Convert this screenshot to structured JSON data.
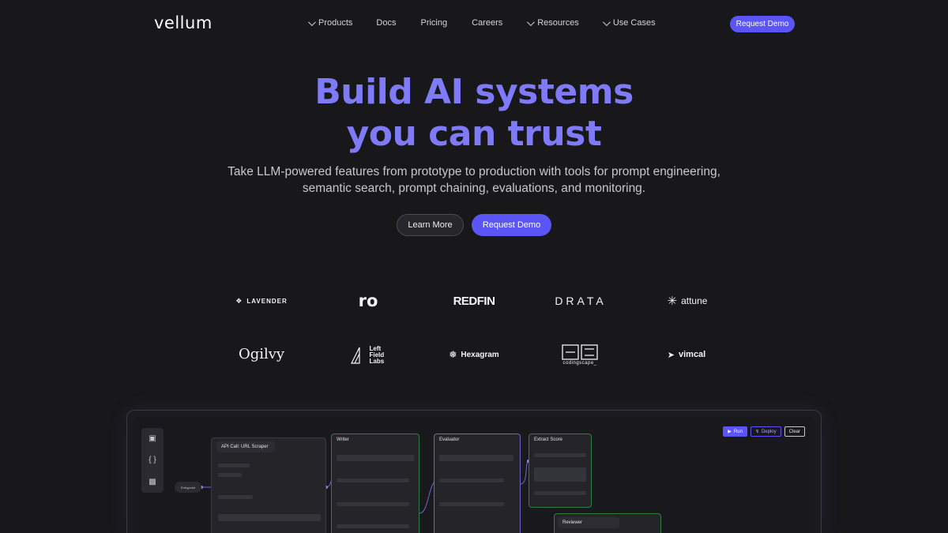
{
  "brand": {
    "name": "vellum"
  },
  "nav": {
    "items": [
      {
        "label": "Products",
        "dropdown": true
      },
      {
        "label": "Docs",
        "dropdown": false
      },
      {
        "label": "Pricing",
        "dropdown": false
      },
      {
        "label": "Careers",
        "dropdown": false
      },
      {
        "label": "Resources",
        "dropdown": true
      },
      {
        "label": "Use Cases",
        "dropdown": true
      }
    ],
    "cta": "Request Demo"
  },
  "hero": {
    "title_line1": "Build AI systems",
    "title_line2": "you can trust",
    "subtitle_line1": "Take LLM-powered features from prototype to production with tools for prompt engineering,",
    "subtitle_line2": "semantic search, prompt chaining, evaluations, and monitoring.",
    "secondary_button": "Learn More",
    "primary_button": "Request Demo"
  },
  "customers": {
    "row1": [
      "LAVENDER",
      "ro",
      "REDFIN",
      "DRATA",
      "attune"
    ],
    "row2": [
      "Ogilvy",
      "Left Field Labs",
      "Hexagram",
      "codingscape_",
      "vimcal"
    ]
  },
  "preview": {
    "buttons": {
      "run": "Run",
      "deploy": "Deploy",
      "clear": "Clear"
    },
    "entry_label": "Entrypoint",
    "nodes": {
      "api": "API Call: URL Scraper",
      "writer": "Writer",
      "evaluator": "Evaluator",
      "extract": "Extract Score",
      "reviewer": "Reviewer"
    }
  },
  "colors": {
    "background": "#18181b",
    "accent": "#5b55f6",
    "hero_text": "#7f7af7"
  }
}
